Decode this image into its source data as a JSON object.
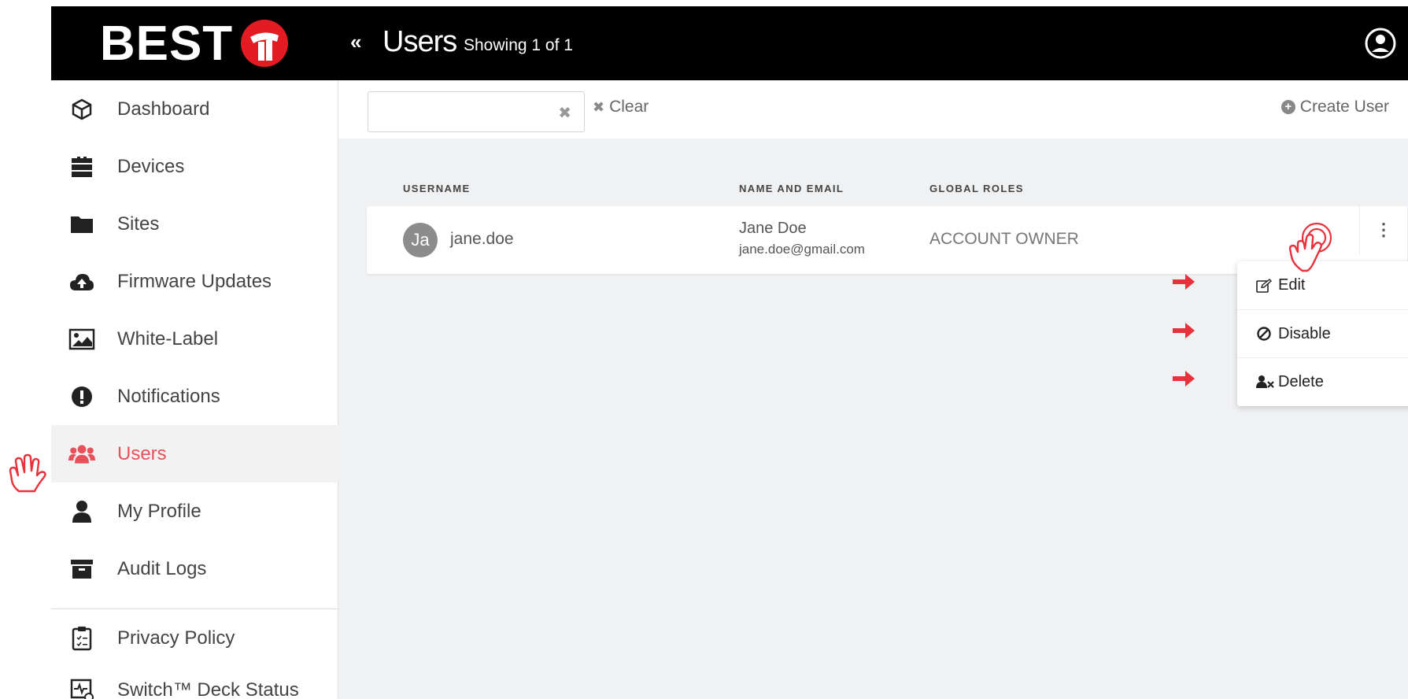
{
  "brand": {
    "text": "BEST",
    "accent": "#e31b23"
  },
  "header": {
    "title": "Users",
    "subtitle": "Showing 1 of 1",
    "collapse": "«"
  },
  "sidebar": {
    "items": [
      {
        "label": "Dashboard",
        "icon": "cube-icon"
      },
      {
        "label": "Devices",
        "icon": "devices-icon"
      },
      {
        "label": "Sites",
        "icon": "folder-icon"
      },
      {
        "label": "Firmware Updates",
        "icon": "cloud-upload-icon"
      },
      {
        "label": "White-Label",
        "icon": "image-icon"
      },
      {
        "label": "Notifications",
        "icon": "exclamation-icon"
      },
      {
        "label": "Users",
        "icon": "users-icon",
        "active": true
      },
      {
        "label": "My Profile",
        "icon": "user-icon"
      },
      {
        "label": "Audit Logs",
        "icon": "archive-icon"
      },
      {
        "label": "Privacy Policy",
        "icon": "clipboard-icon"
      },
      {
        "label": "Switch™ Deck Status",
        "icon": "status-icon"
      }
    ],
    "active_color": "#e8515a"
  },
  "toolbar": {
    "search_value": "",
    "search_clear_glyph": "✖",
    "clear_label": "Clear",
    "create_label": "Create User"
  },
  "table": {
    "headers": {
      "username": "USERNAME",
      "name_email": "NAME AND EMAIL",
      "roles": "GLOBAL ROLES"
    },
    "rows": [
      {
        "avatar": "Ja",
        "username": "jane.doe",
        "name": "Jane Doe",
        "email": "jane.doe@gmail.com",
        "role": "ACCOUNT OWNER",
        "menu_glyph": "⋮"
      }
    ]
  },
  "row_menu": {
    "items": [
      {
        "label": "Edit",
        "icon": "edit-icon"
      },
      {
        "label": "Disable",
        "icon": "ban-icon"
      },
      {
        "label": "Delete",
        "icon": "user-delete-icon"
      }
    ]
  },
  "annotation_color": "#e8313a"
}
